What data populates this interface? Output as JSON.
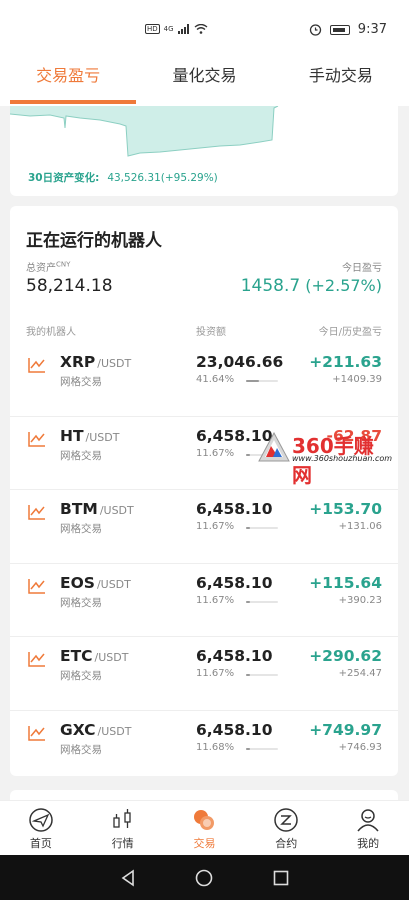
{
  "status": {
    "left_label": "HD",
    "network": "4G",
    "time": "9:37"
  },
  "tabs": [
    {
      "label": "交易盈亏",
      "active": true
    },
    {
      "label": "量化交易",
      "active": false
    },
    {
      "label": "手动交易",
      "active": false
    }
  ],
  "asset_change": {
    "label": "30日资产变化:",
    "value": "43,526.31(+95.29%)"
  },
  "robots_card": {
    "title": "正在运行的机器人",
    "total_assets_label": "总资产",
    "total_assets_unit": "CNY",
    "total_assets_value": "58,214.18",
    "today_profit_label": "今日盈亏",
    "today_profit_value": "1458.7",
    "today_profit_pct": "(+2.57%)",
    "col_robot": "我的机器人",
    "col_invest": "投资额",
    "col_profit": "今日/历史盈亏"
  },
  "robots": [
    {
      "base": "XRP",
      "quote": "/USDT",
      "strategy": "网格交易",
      "invest": "23,046.66",
      "pct": "41.64%",
      "pct_value": 0.4164,
      "today": "+211.63",
      "hist": "+1409.39",
      "today_negative": false
    },
    {
      "base": "HT",
      "quote": "/USDT",
      "strategy": "网格交易",
      "invest": "6,458.10",
      "pct": "11.67%",
      "pct_value": 0.1167,
      "today": "-62.87",
      "hist": "",
      "today_negative": true
    },
    {
      "base": "BTM",
      "quote": "/USDT",
      "strategy": "网格交易",
      "invest": "6,458.10",
      "pct": "11.67%",
      "pct_value": 0.1167,
      "today": "+153.70",
      "hist": "+131.06",
      "today_negative": false
    },
    {
      "base": "EOS",
      "quote": "/USDT",
      "strategy": "网格交易",
      "invest": "6,458.10",
      "pct": "11.67%",
      "pct_value": 0.1167,
      "today": "+115.64",
      "hist": "+390.23",
      "today_negative": false
    },
    {
      "base": "ETC",
      "quote": "/USDT",
      "strategy": "网格交易",
      "invest": "6,458.10",
      "pct": "11.67%",
      "pct_value": 0.1167,
      "today": "+290.62",
      "hist": "+254.47",
      "today_negative": false
    },
    {
      "base": "GXC",
      "quote": "/USDT",
      "strategy": "网格交易",
      "invest": "6,458.10",
      "pct": "11.68%",
      "pct_value": 0.1168,
      "today": "+749.97",
      "hist": "+746.93",
      "today_negative": false
    }
  ],
  "watermark": {
    "text": "360手赚网",
    "url": "www.360shouzhuan.com"
  },
  "bottom_nav": [
    {
      "label": "首页",
      "icon": "home-icon",
      "active": false
    },
    {
      "label": "行情",
      "icon": "market-icon",
      "active": false
    },
    {
      "label": "交易",
      "icon": "trade-icon",
      "active": true
    },
    {
      "label": "合约",
      "icon": "contract-icon",
      "active": false
    },
    {
      "label": "我的",
      "icon": "profile-icon",
      "active": false
    }
  ],
  "colors": {
    "accent": "#ef7a3a",
    "positive": "#2aa38e",
    "negative": "#e84b3c"
  }
}
